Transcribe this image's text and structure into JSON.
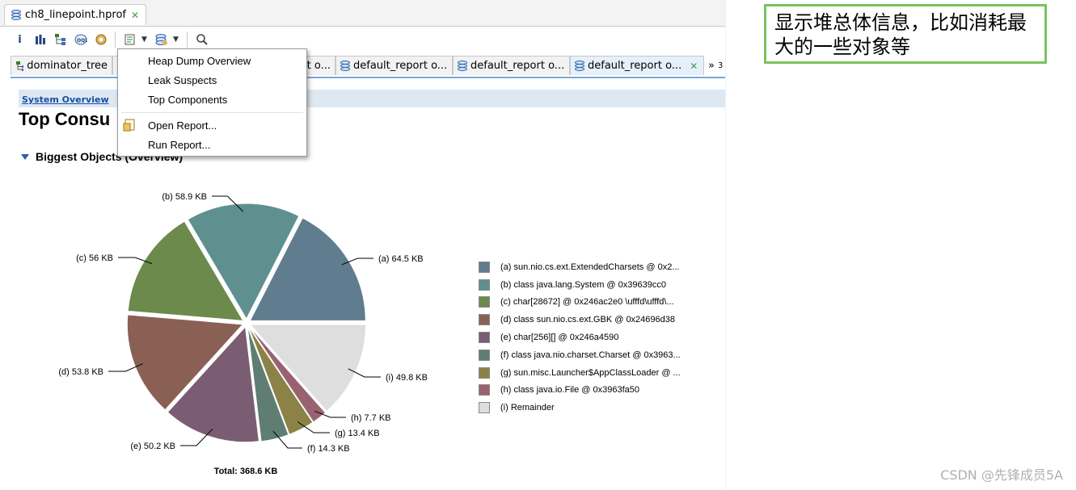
{
  "editor_tab": {
    "title": "ch8_linepoint.hprof",
    "close": "✕"
  },
  "toolbar": {
    "icons": [
      "info-icon",
      "histogram-icon",
      "dominator-tree-icon",
      "oql-icon",
      "thread-overview-icon",
      "report-run-icon",
      "heap-dump-actions-icon",
      "search-icon"
    ]
  },
  "view_tabs": [
    {
      "label": "dominator_tree",
      "icon": "tree-icon"
    },
    {
      "label": "t o...",
      "icon": "none"
    },
    {
      "label": "default_report  o...",
      "icon": "report-icon"
    },
    {
      "label": "default_report  o...",
      "icon": "report-icon"
    },
    {
      "label": "default_report  o...",
      "icon": "report-icon",
      "active": true
    }
  ],
  "overflow_label": "»",
  "overflow_count": "3",
  "breadcrumb": "System Overview",
  "page_title": "Top Consu",
  "section_title": "Biggest Objects (Overview)",
  "dropdown": {
    "items": [
      "Heap Dump Overview",
      "Leak Suspects",
      "Top Components",
      "Open Report...",
      "Run Report..."
    ]
  },
  "chart_data": {
    "type": "pie",
    "total_label": "Total: 368.6 KB",
    "slices": [
      {
        "id": "a",
        "label": "(a)  64.5 KB",
        "value": 64.5,
        "color": "#5f7d8f",
        "legend": "(a)  sun.nio.cs.ext.ExtendedCharsets @ 0x2..."
      },
      {
        "id": "b",
        "label": "(b)  58.9 KB",
        "value": 58.9,
        "color": "#5f9090",
        "legend": "(b)  class java.lang.System @ 0x39639cc0"
      },
      {
        "id": "c",
        "label": "(c)  56 KB",
        "value": 56,
        "color": "#6b8a4c",
        "legend": "(c)  char[28672] @ 0x246ac2e0  \\ufffd\\ufffd\\..."
      },
      {
        "id": "d",
        "label": "(d)  53.8 KB",
        "value": 53.8,
        "color": "#8a6055",
        "legend": "(d)  class sun.nio.cs.ext.GBK @ 0x24696d38"
      },
      {
        "id": "e",
        "label": "(e)  50.2 KB",
        "value": 50.2,
        "color": "#7a5d72",
        "legend": "(e)  char[256][] @ 0x246a4590"
      },
      {
        "id": "f",
        "label": "(f)  14.3 KB",
        "value": 14.3,
        "color": "#5f7d72",
        "legend": "(f)  class java.nio.charset.Charset @ 0x3963..."
      },
      {
        "id": "g",
        "label": "(g)  13.4 KB",
        "value": 13.4,
        "color": "#8c8248",
        "legend": "(g)  sun.misc.Launcher$AppClassLoader @ ..."
      },
      {
        "id": "h",
        "label": "(h)  7.7 KB",
        "value": 7.7,
        "color": "#9a6270",
        "legend": "(h)  class java.io.File @ 0x3963fa50"
      },
      {
        "id": "i",
        "label": "(i)  49.8 KB",
        "value": 49.8,
        "color": "#dedede",
        "legend": "(i)  Remainder"
      }
    ]
  },
  "annotation": "显示堆总体信息，比如消耗最大的一些对象等",
  "watermark": "CSDN @先锋成员5A"
}
